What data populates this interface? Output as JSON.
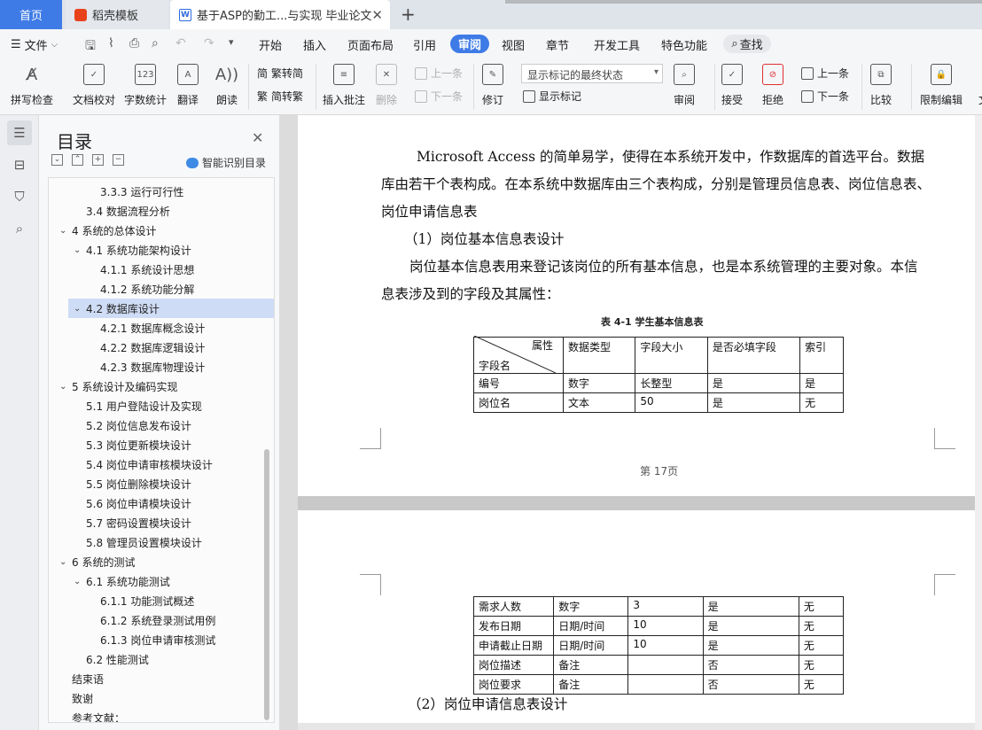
{
  "tabs": {
    "home": "首页",
    "wps": "稻壳模板",
    "doc": "基于ASP的勤工...与实现 毕业论文",
    "new_tab": "+"
  },
  "menu": {
    "file": "文件",
    "items": [
      "开始",
      "插入",
      "页面布局",
      "引用",
      "审阅",
      "视图",
      "章节",
      "开发工具",
      "特色功能"
    ],
    "active": "审阅",
    "search": "查找"
  },
  "ribbon": {
    "spell": "拼写检查",
    "proof": "文档校对",
    "wordcount": "字数统计",
    "translate": "翻译",
    "read": "朗读",
    "trad": "繁转简",
    "simp": "简转繁",
    "insert_comment": "插入批注",
    "delete": "删除",
    "prev_comment": "上一条",
    "next_comment": "下一条",
    "revise": "修订",
    "markup_state": "显示标记的最终状态",
    "show_markup": "显示标记",
    "review": "审阅",
    "accept": "接受",
    "reject": "拒绝",
    "prev": "上一条",
    "next": "下一条",
    "compare": "比较",
    "restrict": "限制编辑",
    "doc_cut": "文"
  },
  "toc": {
    "title": "目录",
    "smart": "智能识别目录",
    "items": [
      {
        "label": "3.3.3  运行可行性",
        "level": 3
      },
      {
        "label": "3.4 数据流程分析",
        "level": 2
      },
      {
        "label": "4   系统的总体设计",
        "level": 1,
        "expanded": true
      },
      {
        "label": "4.1 系统功能架构设计",
        "level": 2,
        "expanded": true
      },
      {
        "label": "4.1.1 系统设计思想",
        "level": 3
      },
      {
        "label": "4.1.2  系统功能分解",
        "level": 3
      },
      {
        "label": "4.2 数据库设计",
        "level": 2,
        "expanded": true,
        "selected": true
      },
      {
        "label": "4.2.1  数据库概念设计",
        "level": 3
      },
      {
        "label": "4.2.2  数据库逻辑设计",
        "level": 3
      },
      {
        "label": "4.2.3  数据库物理设计",
        "level": 3
      },
      {
        "label": "5   系统设计及编码实现",
        "level": 1,
        "expanded": true
      },
      {
        "label": "5.1 用户登陆设计及实现",
        "level": 2
      },
      {
        "label": "5.2  岗位信息发布设计",
        "level": 2
      },
      {
        "label": "5.3 岗位更新模块设计",
        "level": 2
      },
      {
        "label": "5.4  岗位申请审核模块设计",
        "level": 2
      },
      {
        "label": "5.5  岗位删除模块设计",
        "level": 2
      },
      {
        "label": "5.6  岗位申请模块设计",
        "level": 2
      },
      {
        "label": "5.7  密码设置模块设计",
        "level": 2
      },
      {
        "label": "5.8  管理员设置模块设计",
        "level": 2
      },
      {
        "label": "6  系统的测试",
        "level": 1,
        "expanded": true
      },
      {
        "label": "6.1 系统功能测试",
        "level": 2,
        "expanded": true
      },
      {
        "label": "6.1.1  功能测试概述",
        "level": 3
      },
      {
        "label": "6.1.2  系统登录测试用例",
        "level": 3
      },
      {
        "label": "6.1.3  岗位申请审核测试",
        "level": 3
      },
      {
        "label": "6.2  性能测试",
        "level": 2
      },
      {
        "label": "结束语",
        "level": 0
      },
      {
        "label": "致谢",
        "level": 0
      },
      {
        "label": "参考文献：",
        "level": 0
      }
    ]
  },
  "doc": {
    "para1_line1": "Microsoft Access 的简单易学，使得在本系统开发中，作数据库的首选平台。数据",
    "para1_line2": "库由若干个表构成。在本系统中数据库由三个表构成，分别是管理员信息表、岗位信息表、",
    "para1_line3": "岗位申请信息表",
    "heading1": "（1）岗位基本信息表设计",
    "para2_line1": "岗位基本信息表用来登记该岗位的所有基本信息，也是本系统管理的主要对象。本信",
    "para2_line2": "息表涉及到的字段及其属性：",
    "table_caption": "表 4-1   学生基本信息表",
    "table_header": {
      "attr": "属性",
      "field": "字段名",
      "cols": [
        "数据类型",
        "字段大小",
        "是否必填字段",
        "索引"
      ]
    },
    "table1_rows": [
      [
        "编号",
        "数字",
        "长整型",
        "是",
        "是"
      ],
      [
        "岗位名",
        "文本",
        "50",
        "是",
        "无"
      ]
    ],
    "page_label": "第 17页",
    "table2_rows": [
      [
        "需求人数",
        "数字",
        "3",
        "是",
        "无"
      ],
      [
        "发布日期",
        "日期/时间",
        "10",
        "是",
        "无"
      ],
      [
        "申请截止日期",
        "日期/时间",
        "10",
        "是",
        "无"
      ],
      [
        "岗位描述",
        "备注",
        "",
        "否",
        "无"
      ],
      [
        "岗位要求",
        "备注",
        "",
        "否",
        "无"
      ]
    ],
    "heading2": "（2）岗位申请信息表设计"
  },
  "icons": {
    "sidebar": [
      "toc-icon",
      "outline-icon",
      "bookmark-icon",
      "search-icon"
    ]
  },
  "colors": {
    "accent": "#3e7be6",
    "selected": "#cfdcf5"
  }
}
